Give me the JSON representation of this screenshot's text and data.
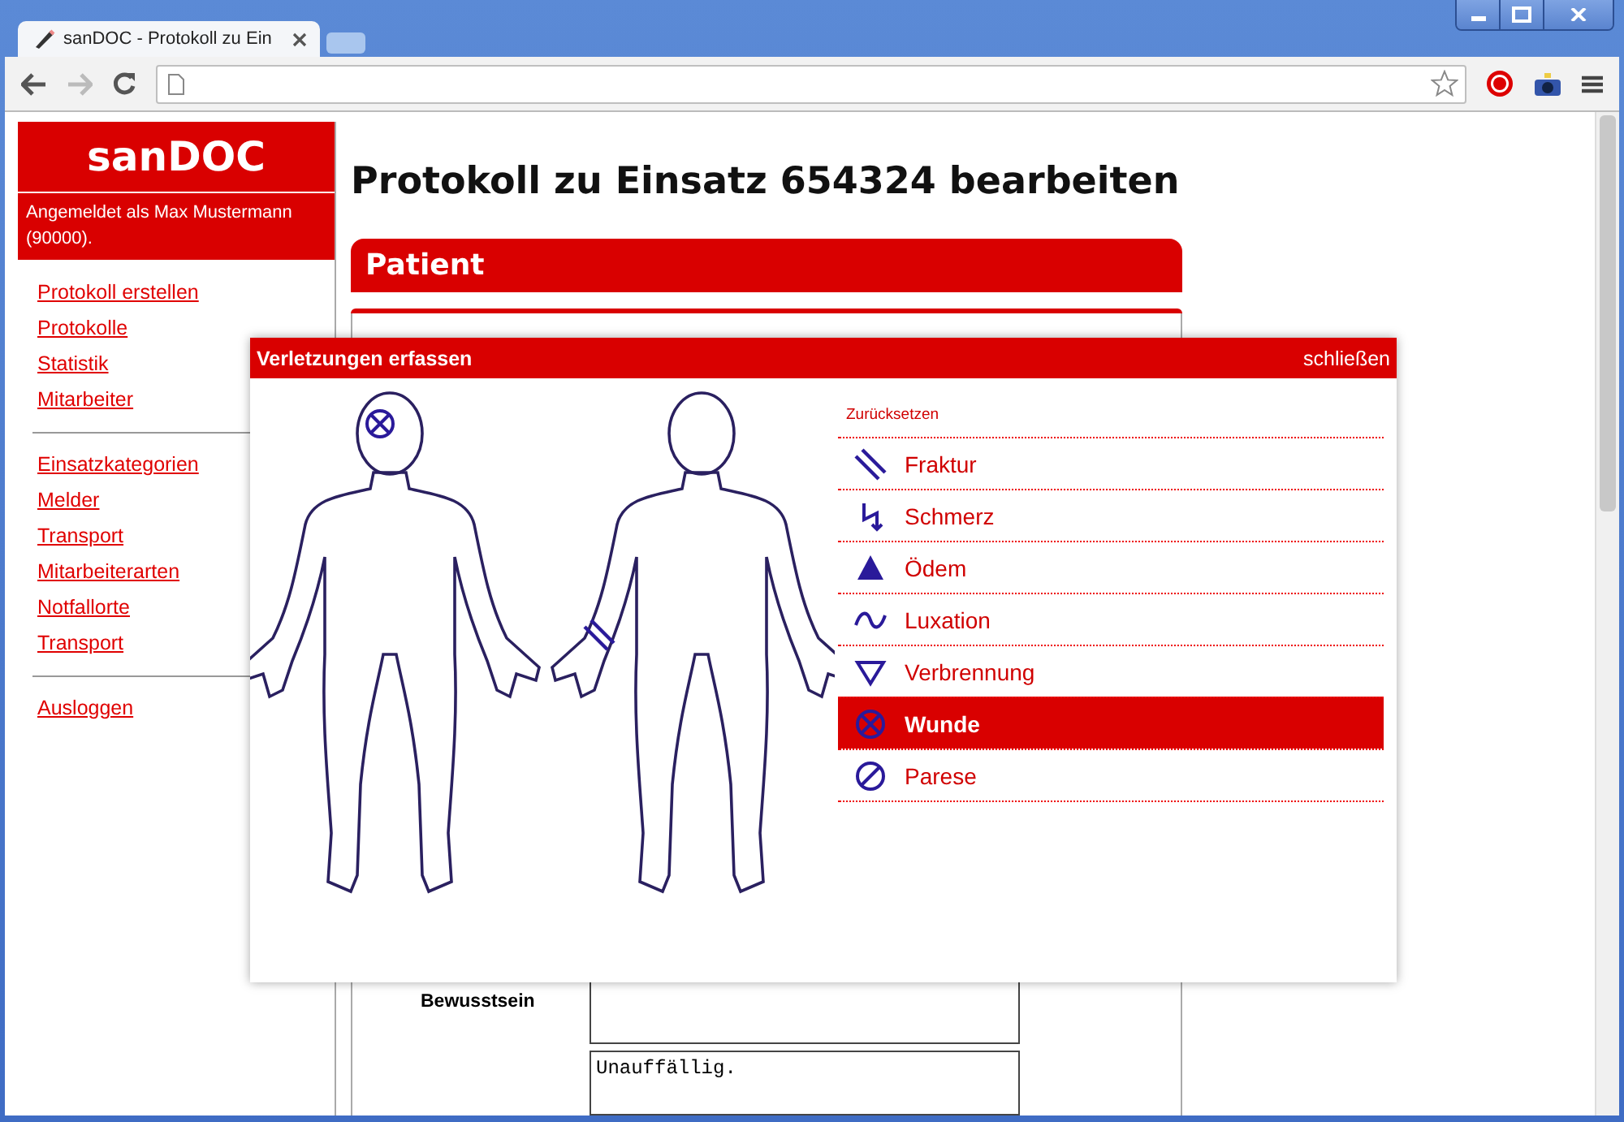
{
  "browser": {
    "tab_title": "sanDOC - Protokoll zu Ein"
  },
  "sidebar": {
    "brand": "sanDOC",
    "login_info": "Angemeldet als Max Mustermann (90000).",
    "groups": [
      [
        "Protokoll erstellen",
        "Protokolle",
        "Statistik",
        "Mitarbeiter"
      ],
      [
        "Einsatzkategorien",
        "Melder",
        "Transport",
        "Mitarbeiterarten",
        "Notfallorte",
        "Transport"
      ],
      [
        "Ausloggen"
      ]
    ]
  },
  "page": {
    "heading": "Protokoll zu Einsatz 654324 bearbeiten",
    "panel_title": "Patient",
    "form": {
      "label": "Bewusstsein",
      "note_value": "Unauffällig."
    }
  },
  "dialog": {
    "title": "Verletzungen erfassen",
    "close": "schließen",
    "reset": "Zurücksetzen",
    "markers": {
      "front_head": {
        "kind": "wunde"
      },
      "back_left_wrist": {
        "kind": "fraktur"
      }
    },
    "legend": [
      {
        "kind": "fraktur",
        "label": "Fraktur",
        "selected": false
      },
      {
        "kind": "schmerz",
        "label": "Schmerz",
        "selected": false
      },
      {
        "kind": "oedem",
        "label": "Ödem",
        "selected": false
      },
      {
        "kind": "luxation",
        "label": "Luxation",
        "selected": false
      },
      {
        "kind": "verbrennung",
        "label": "Verbrennung",
        "selected": false
      },
      {
        "kind": "wunde",
        "label": "Wunde",
        "selected": true
      },
      {
        "kind": "parese",
        "label": "Parese",
        "selected": false
      }
    ]
  }
}
